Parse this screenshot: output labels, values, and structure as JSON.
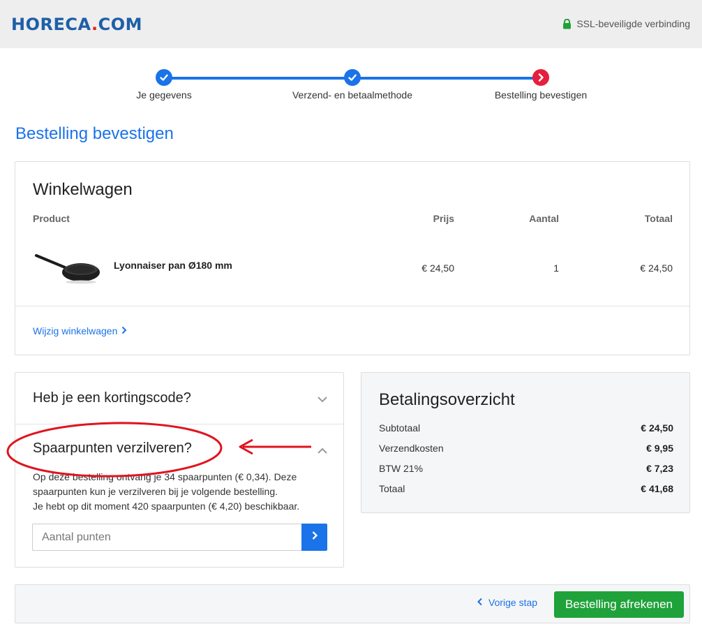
{
  "header": {
    "logo_main": "HORECA",
    "logo_dot": ".",
    "logo_tld": "COM",
    "ssl_text": "SSL-beveiligde verbinding"
  },
  "steps": [
    {
      "label": "Je gegevens",
      "state": "done"
    },
    {
      "label": "Verzend- en betaalmethode",
      "state": "done"
    },
    {
      "label": "Bestelling bevestigen",
      "state": "current"
    }
  ],
  "page_title": "Bestelling bevestigen",
  "cart": {
    "title": "Winkelwagen",
    "columns": {
      "product": "Product",
      "price": "Prijs",
      "qty": "Aantal",
      "total": "Totaal"
    },
    "items": [
      {
        "name": "Lyonnaiser pan Ø180 mm",
        "price": "€ 24,50",
        "qty": "1",
        "total": "€ 24,50"
      }
    ],
    "edit_link": "Wijzig winkelwagen"
  },
  "promo": {
    "discount_title": "Heb je een kortingscode?",
    "points_title": "Spaarpunten verzilveren?",
    "points_desc_1": "Op deze bestelling ontvang je 34 spaarpunten (€ 0,34). Deze spaarpunten kun je verzilveren bij je volgende bestelling.",
    "points_desc_2": "Je hebt op dit moment 420 spaarpunten (€ 4,20) beschikbaar.",
    "points_placeholder": "Aantal punten"
  },
  "summary": {
    "title": "Betalingsoverzicht",
    "rows": [
      {
        "label": "Subtotaal",
        "value": "€ 24,50"
      },
      {
        "label": "Verzendkosten",
        "value": "€ 9,95"
      },
      {
        "label": "BTW 21%",
        "value": "€ 7,23"
      },
      {
        "label": "Totaal",
        "value": "€ 41,68"
      }
    ]
  },
  "footer": {
    "prev_label": "Vorige stap",
    "checkout_label": "Bestelling afrekenen"
  },
  "colors": {
    "brand_blue": "#1e5fa8",
    "accent_blue": "#1a73e8",
    "logo_red": "#e2231a",
    "step_current": "#e5203c",
    "checkout_green": "#1fa23a",
    "annotation_red": "#e0141e"
  }
}
